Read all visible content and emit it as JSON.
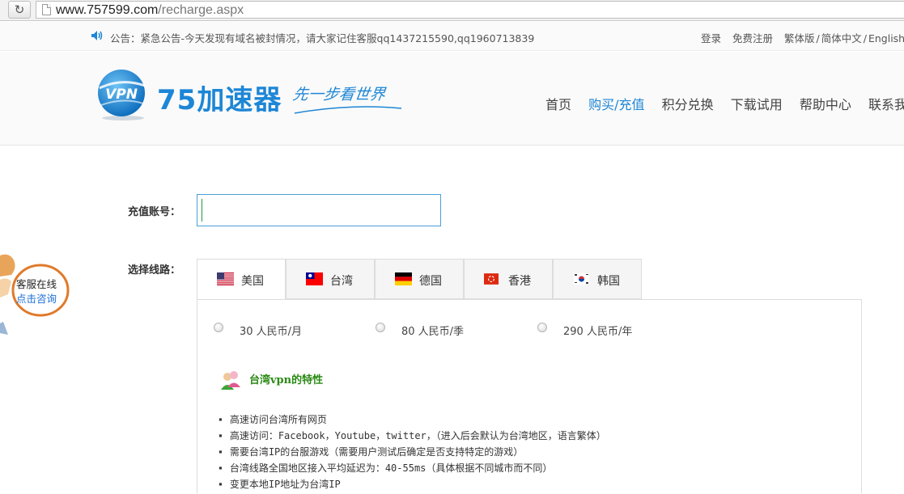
{
  "browser": {
    "url_host": "www.757599.com",
    "url_path": "/recharge.aspx"
  },
  "topbar": {
    "notice": "公告：紧急公告-今天发现有域名被封情况，请大家记住客服qq1437215590,qq1960713839",
    "login": "登录",
    "register": "免费注册",
    "lang_trad": "繁体版",
    "lang_sep": "/",
    "lang_simp": "简体中文",
    "lang_sep2": "/",
    "lang_en": "English"
  },
  "header": {
    "logo_text": "75加速器",
    "logo_badge": "VPN",
    "slogan": "先一步看世界",
    "nav": [
      "首页",
      "购买/充值",
      "积分兑换",
      "下载试用",
      "帮助中心",
      "联系我们"
    ],
    "nav_active_index": 1
  },
  "form": {
    "account_label": "充值账号：",
    "account_value": "",
    "route_label": "选择线路：",
    "tabs": [
      {
        "label": "美国",
        "flag": "us-flag"
      },
      {
        "label": "台湾",
        "flag": "tw-flag"
      },
      {
        "label": "德国",
        "flag": "de-flag"
      },
      {
        "label": "香港",
        "flag": "hk-flag"
      },
      {
        "label": "韩国",
        "flag": "kr-flag"
      }
    ],
    "active_tab": 0,
    "prices": [
      "30 人民币/月",
      "80 人民币/季",
      "290 人民币/年"
    ],
    "feature_title": "台湾vpn的特性",
    "features": [
      "高速访问台湾所有网页",
      "高速访问：Facebook，Youtube，twitter，（进入后会默认为台湾地区，语言繁体）",
      "需要台湾IP的台服游戏（需要用户测试后确定是否支持特定的游戏）",
      "台湾线路全国地区接入平均延迟为：40-55ms（具体根据不同城市而不同）",
      "变更本地IP地址为台湾IP"
    ]
  },
  "service": {
    "line1": "客服在线",
    "line2": "点击咨询"
  },
  "colors": {
    "brand": "#1d86d6",
    "feature_title": "#2a8a14",
    "service_orange": "#e07a2a"
  }
}
